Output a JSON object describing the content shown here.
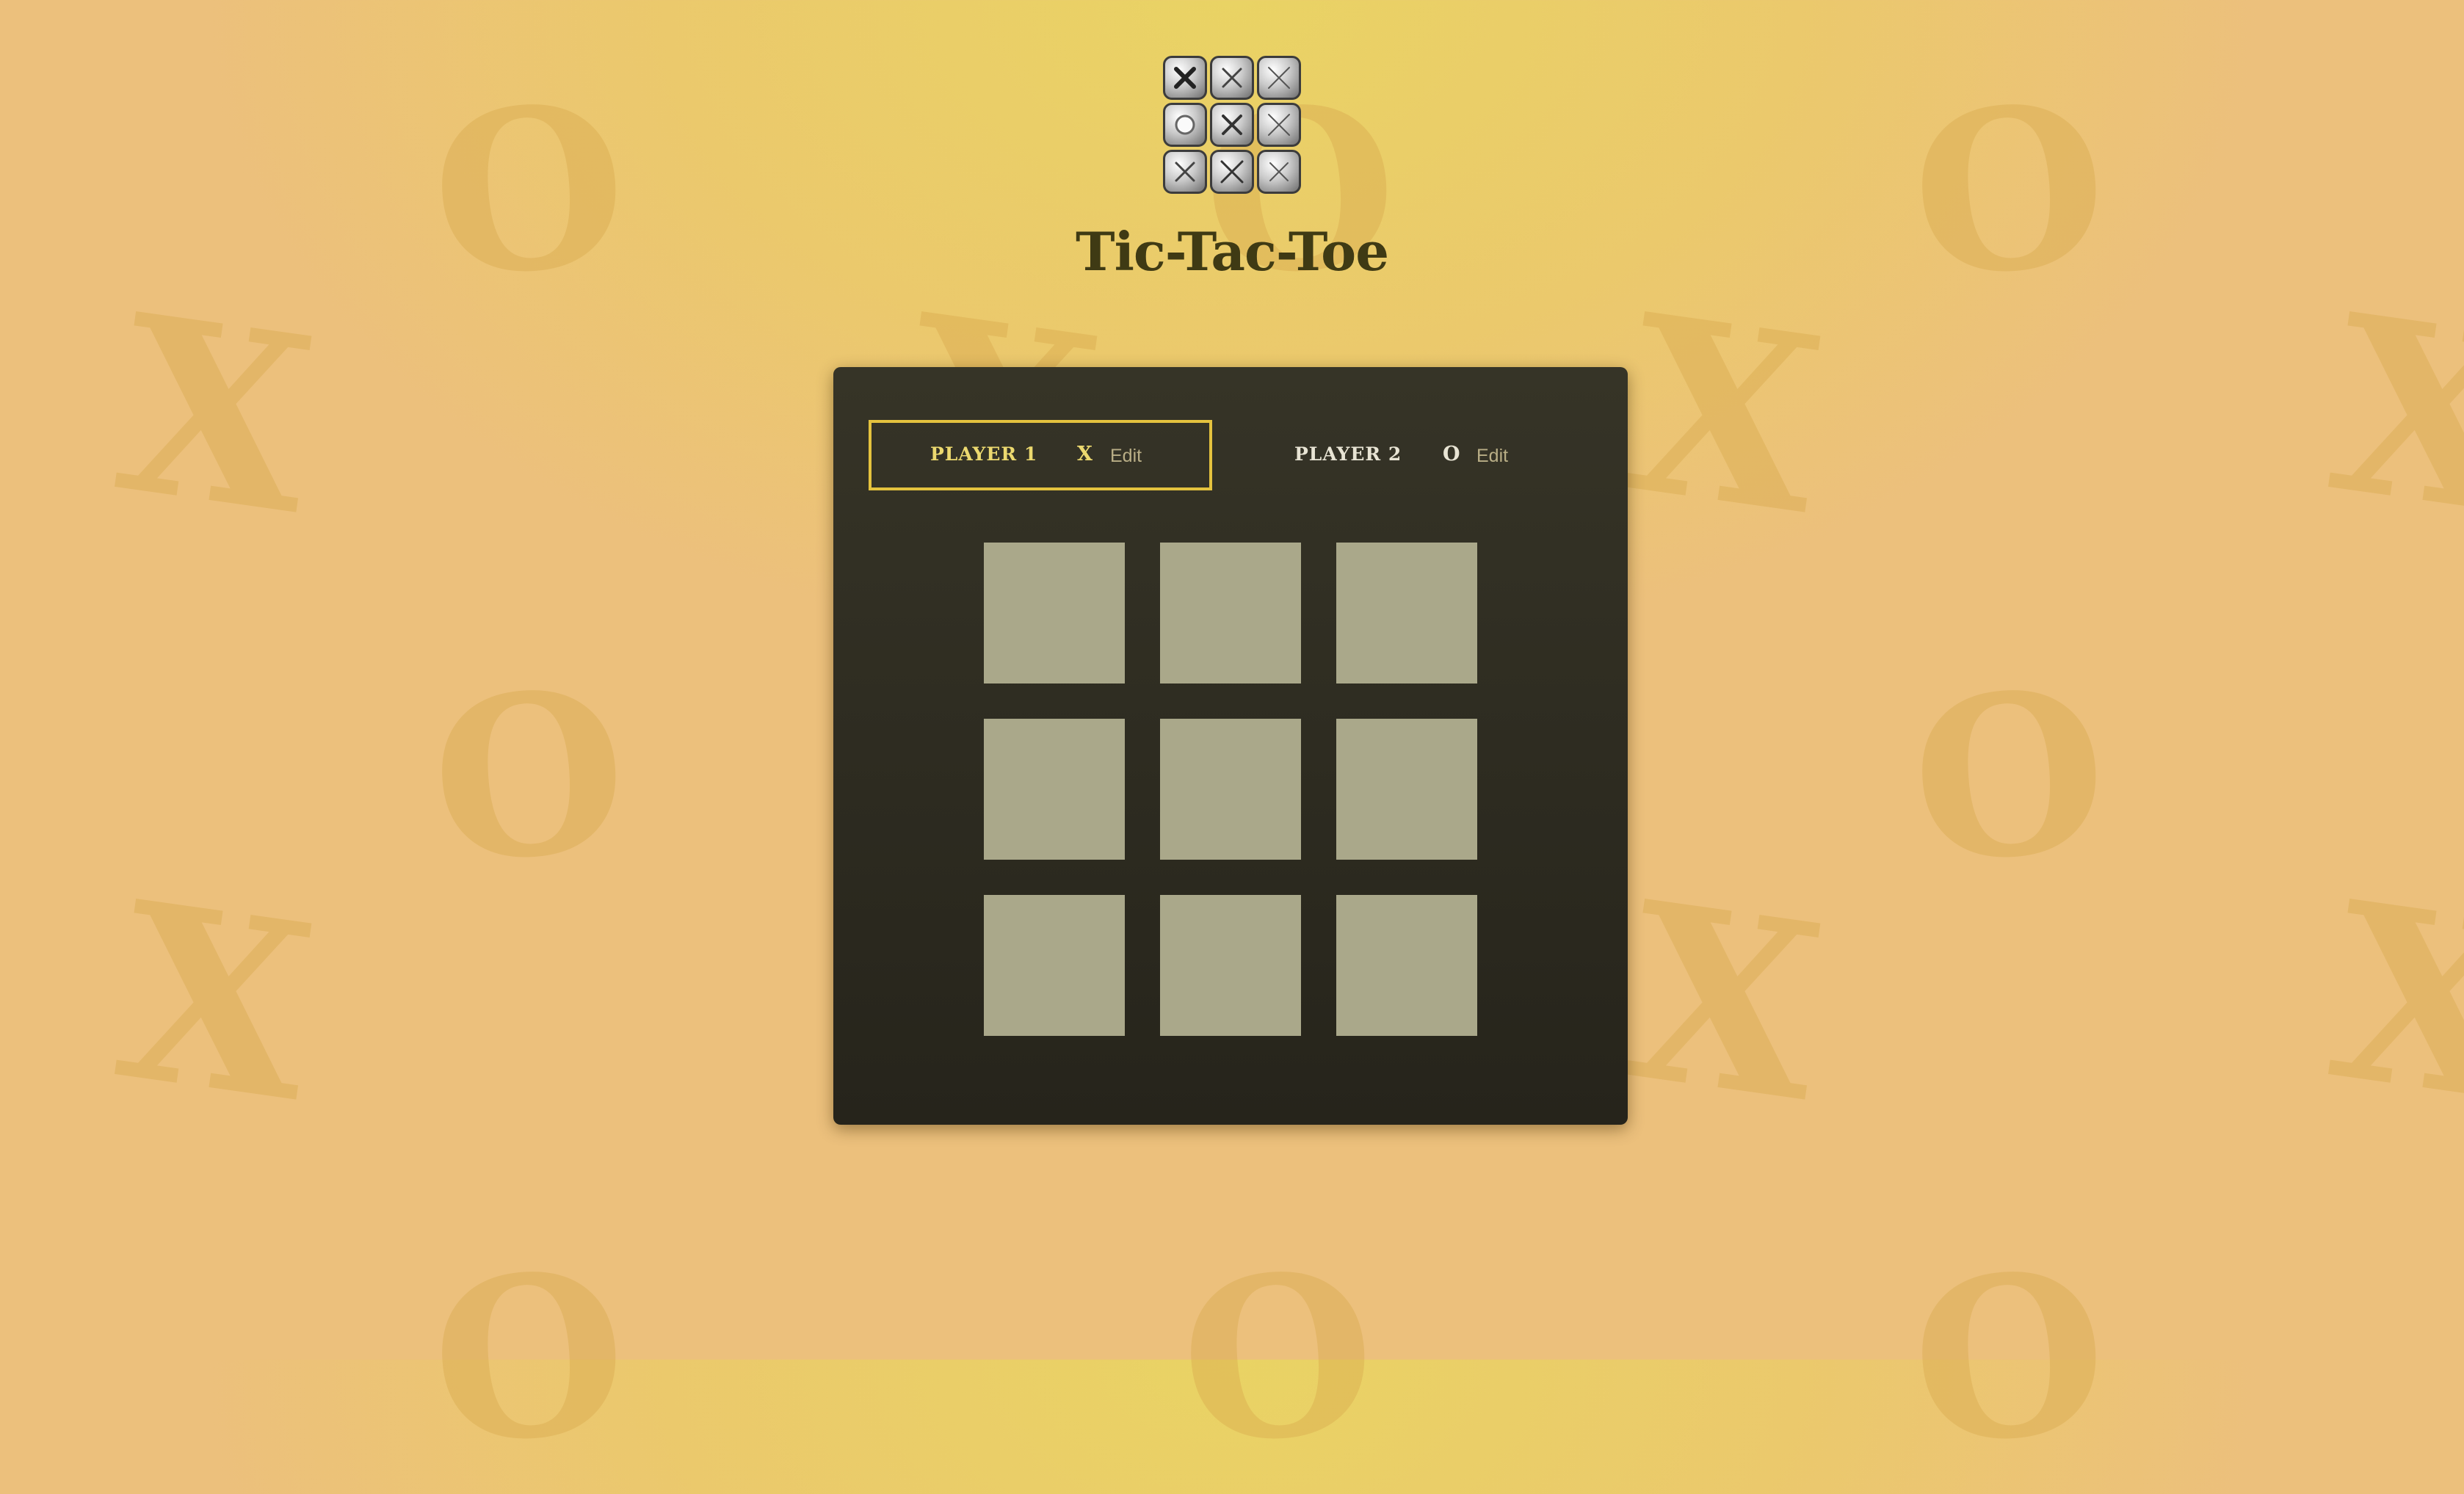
{
  "app": {
    "title": "Tic-Tac-Toe",
    "logo_icon": "tic-tac-toe-tiles-icon"
  },
  "players": [
    {
      "name": "PLAYER 1",
      "symbol": "X",
      "edit_label": "Edit",
      "active": true
    },
    {
      "name": "PLAYER 2",
      "symbol": "O",
      "edit_label": "Edit",
      "active": false
    }
  ],
  "board": {
    "cells": [
      "",
      "",
      "",
      "",
      "",
      "",
      "",
      "",
      ""
    ]
  },
  "colors": {
    "background": "#ebc96c",
    "panel": "#2f2d22",
    "active_player_border": "#e4c23e",
    "cell": "#aaa88a",
    "title": "#3f3a14"
  }
}
